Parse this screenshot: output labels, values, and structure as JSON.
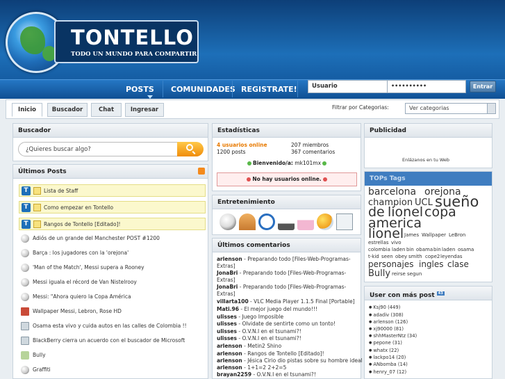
{
  "site": {
    "title": "TONTELLO",
    "subtitle": "TODO UN MUNDO PARA COMPARTIR"
  },
  "nav": {
    "items": [
      "POSTS",
      "COMUNIDADES",
      "REGISTRATE!"
    ]
  },
  "login": {
    "user_value": "Usuario",
    "password_value": "••••••••••",
    "submit_label": "Entrar"
  },
  "tabs": [
    "Inicio",
    "Buscador",
    "Chat",
    "Ingresar"
  ],
  "filter": {
    "label": "Filtrar por Categorias:",
    "selected": "Ver categorias"
  },
  "buscador": {
    "title": "Buscador",
    "placeholder": "¿Quieres buscar algo?"
  },
  "ultimos_posts": {
    "title": "Últimos Posts",
    "sticky": [
      "Lista de Staff",
      "Como empezar en Tontello",
      "Rangos de Tontello [Editado]!"
    ],
    "posts": [
      "Adiós de un grande del Manchester POST #1200",
      "Barça : los jugadores con la 'orejona'",
      "'Man of the Match', Messi supera a Rooney",
      "Messi iguala el récord de Van Nistelrooy",
      "Messi: \"Ahora quiero la Copa América",
      "Wallpaper Messi, Lebron, Rose HD",
      "Osama esta vivo y cuida autos en las calles de Colombia !!",
      "BlackBerry cierra un acuerdo con el buscador de Microsoft",
      "Bully",
      "Graffiti"
    ]
  },
  "estadisticas": {
    "title": "Estadísticas",
    "online": "4 usuarios online",
    "posts": "1200 posts",
    "miembros": "207 miembros",
    "comentarios": "367 comentarios",
    "bienvenido_label": "Bienvenido/a:",
    "bienvenido_user": "mk101mx",
    "no_online": "No hay usuarios online."
  },
  "entretenimiento": {
    "title": "Entretenimiento",
    "icons": [
      "soccer-ball-icon",
      "radar-icon",
      "clock-icon",
      "joystick-icon",
      "cake-icon",
      "weather-icon",
      "newspaper-icon"
    ]
  },
  "ultimos_comentarios": {
    "title": "Últimos comentarios",
    "lines": [
      {
        "user": "arlenson",
        "text": " - Preparando todo [Files-Web-Programas-"
      },
      {
        "user": "",
        "text": "Extras]"
      },
      {
        "user": "JonaBri",
        "text": " - Preparando todo [Files-Web-Programas-"
      },
      {
        "user": "",
        "text": "Extras]"
      },
      {
        "user": "JonaBri",
        "text": " - Preparando todo [Files-Web-Programas-"
      },
      {
        "user": "",
        "text": "Extras]"
      },
      {
        "user": "villarta100",
        "text": " - VLC Media Player 1.1.5 Final [Portable]"
      },
      {
        "user": "Mati.96",
        "text": " - El mejor juego del mundo!!!"
      },
      {
        "user": "ulisses",
        "text": " - Juego Imposible"
      },
      {
        "user": "ulisses",
        "text": " - Olvidate de sentirte como un tonto!"
      },
      {
        "user": "ulisses",
        "text": " - O.V.N.I en el tsunami?!"
      },
      {
        "user": "ulisses",
        "text": " - O.V.N.I en el tsunami?!"
      },
      {
        "user": "arlenson",
        "text": " - Metin2 Shino"
      },
      {
        "user": "arlenson",
        "text": " - Rangos de Tontello [Editado]!"
      },
      {
        "user": "arlenson",
        "text": " - Jésica Cirio dio pistas sobre su hombre ideal"
      },
      {
        "user": "arlenson",
        "text": " - 1+1=2 2+2=5"
      },
      {
        "user": "brayan2259",
        "text": " - O.V.N.I en el tsunami?!"
      }
    ]
  },
  "publicidad": {
    "title": "Publicidad",
    "text": "Enlázanos en tu Web"
  },
  "tops_tags": {
    "title": "TOPs Tags",
    "tags": [
      "barcelona",
      "orejona",
      "champion",
      "UCL",
      "sueño",
      "de",
      "lionel",
      "copa",
      "america",
      "lionel",
      "James",
      "Wallpaper",
      "LeBron",
      "estrellas",
      "vivo",
      "colombia",
      "laden",
      "bin",
      "obama",
      "bin",
      "laden",
      "osama",
      "t-kid",
      "seen",
      "obey",
      "smith",
      "cope2",
      "leyendas",
      "personajes",
      "ingles",
      "clase",
      "Bully",
      "reirse",
      "segun"
    ]
  },
  "usuarios_top": {
    "title": "User con más post",
    "badge": "43",
    "users": [
      "Ksj90 (449)",
      "adadiv (308)",
      "arlenson (126)",
      "xj90000 (81)",
      "shhMasterNtz (34)",
      "pepone (31)",
      "whatx (22)",
      "lackpo14 (20)",
      "ANbomba (14)",
      "henry_07 (12)"
    ]
  }
}
